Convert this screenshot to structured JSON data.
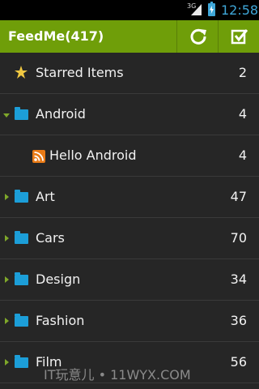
{
  "status_bar": {
    "network": "3G",
    "time": "12:58"
  },
  "action_bar": {
    "title": "FeedMe(417)",
    "refresh_icon": "refresh-icon",
    "mark_read_icon": "checkbox-icon"
  },
  "colors": {
    "accent": "#6f9e09",
    "folder": "#1c9ed8",
    "rss": "#e97a16",
    "star": "#f0c842"
  },
  "list": {
    "starred": {
      "label": "Starred Items",
      "count": "2"
    },
    "android": {
      "label": "Android",
      "count": "4"
    },
    "hello_android": {
      "label": "Hello Android",
      "count": "4"
    },
    "art": {
      "label": "Art",
      "count": "47"
    },
    "cars": {
      "label": "Cars",
      "count": "70"
    },
    "design": {
      "label": "Design",
      "count": "34"
    },
    "fashion": {
      "label": "Fashion",
      "count": "36"
    },
    "film": {
      "label": "Film",
      "count": "56"
    }
  },
  "watermark": "IT玩意儿 • 11WYX.COM"
}
